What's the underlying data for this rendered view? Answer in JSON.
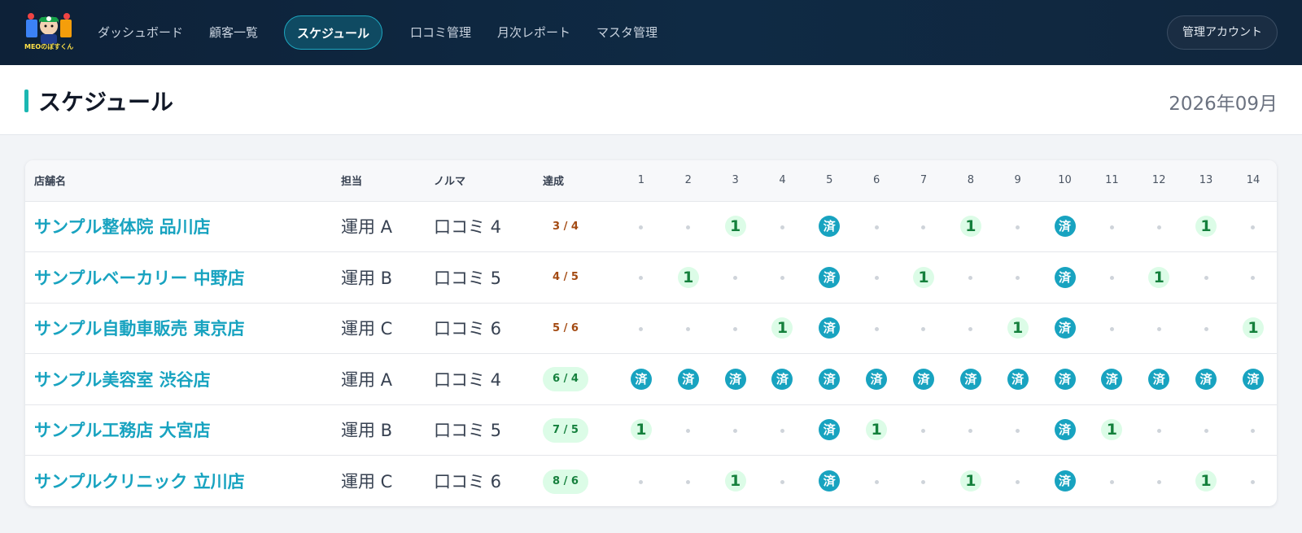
{
  "nav": {
    "logo_text": "MEOのぼすくん",
    "items": [
      {
        "label": "ダッシュボード",
        "active": false
      },
      {
        "label": "顧客一覧",
        "active": false
      },
      {
        "label": "スケジュール",
        "active": true
      },
      {
        "label": "口コミ管理",
        "active": false
      },
      {
        "label": "月次レポート",
        "active": false
      },
      {
        "label": "マスタ管理",
        "active": false
      }
    ],
    "account_label": "管理アカウント"
  },
  "page": {
    "title": "スケジュール",
    "month": "2026年09月"
  },
  "colors": {
    "nav_bg": "#0f2a44",
    "accent": "#18a3c0",
    "title_bar": "#1bb7b2",
    "met_bg": "#dcfce7",
    "met_text": "#15803d",
    "under_text": "#a34a12"
  },
  "table": {
    "headers": {
      "store": "店舗名",
      "owner": "担当",
      "quota": "ノルマ",
      "achievement": "達成"
    },
    "days": [
      "1",
      "2",
      "3",
      "4",
      "5",
      "6",
      "7",
      "8",
      "9",
      "10",
      "11",
      "12",
      "13",
      "14"
    ],
    "legend": {
      "dot": "・",
      "one": "1",
      "done": "済"
    },
    "rows": [
      {
        "store": "サンプル整体院 品川店",
        "owner": "運用 A",
        "quota": "口コミ 4",
        "achievement": "3 / 4",
        "met": false,
        "cells": [
          "dot",
          "dot",
          "one",
          "dot",
          "done",
          "dot",
          "dot",
          "one",
          "dot",
          "done",
          "dot",
          "dot",
          "one",
          "dot"
        ]
      },
      {
        "store": "サンプルベーカリー 中野店",
        "owner": "運用 B",
        "quota": "口コミ 5",
        "achievement": "4 / 5",
        "met": false,
        "cells": [
          "dot",
          "one",
          "dot",
          "dot",
          "done",
          "dot",
          "one",
          "dot",
          "dot",
          "done",
          "dot",
          "one",
          "dot",
          "dot"
        ]
      },
      {
        "store": "サンプル自動車販売 東京店",
        "owner": "運用 C",
        "quota": "口コミ 6",
        "achievement": "5 / 6",
        "met": false,
        "cells": [
          "dot",
          "dot",
          "dot",
          "one",
          "done",
          "dot",
          "dot",
          "dot",
          "one",
          "done",
          "dot",
          "dot",
          "dot",
          "one"
        ]
      },
      {
        "store": "サンプル美容室 渋谷店",
        "owner": "運用 A",
        "quota": "口コミ 4",
        "achievement": "6 / 4",
        "met": true,
        "cells": [
          "done",
          "done",
          "done",
          "done",
          "done",
          "done",
          "done",
          "done",
          "done",
          "done",
          "done",
          "done",
          "done",
          "done"
        ]
      },
      {
        "store": "サンプル工務店 大宮店",
        "owner": "運用 B",
        "quota": "口コミ 5",
        "achievement": "7 / 5",
        "met": true,
        "cells": [
          "one",
          "dot",
          "dot",
          "dot",
          "done",
          "one",
          "dot",
          "dot",
          "dot",
          "done",
          "one",
          "dot",
          "dot",
          "dot"
        ]
      },
      {
        "store": "サンプルクリニック 立川店",
        "owner": "運用 C",
        "quota": "口コミ 6",
        "achievement": "8 / 6",
        "met": true,
        "cells": [
          "dot",
          "dot",
          "one",
          "dot",
          "done",
          "dot",
          "dot",
          "one",
          "dot",
          "done",
          "dot",
          "dot",
          "one",
          "dot"
        ]
      }
    ]
  }
}
